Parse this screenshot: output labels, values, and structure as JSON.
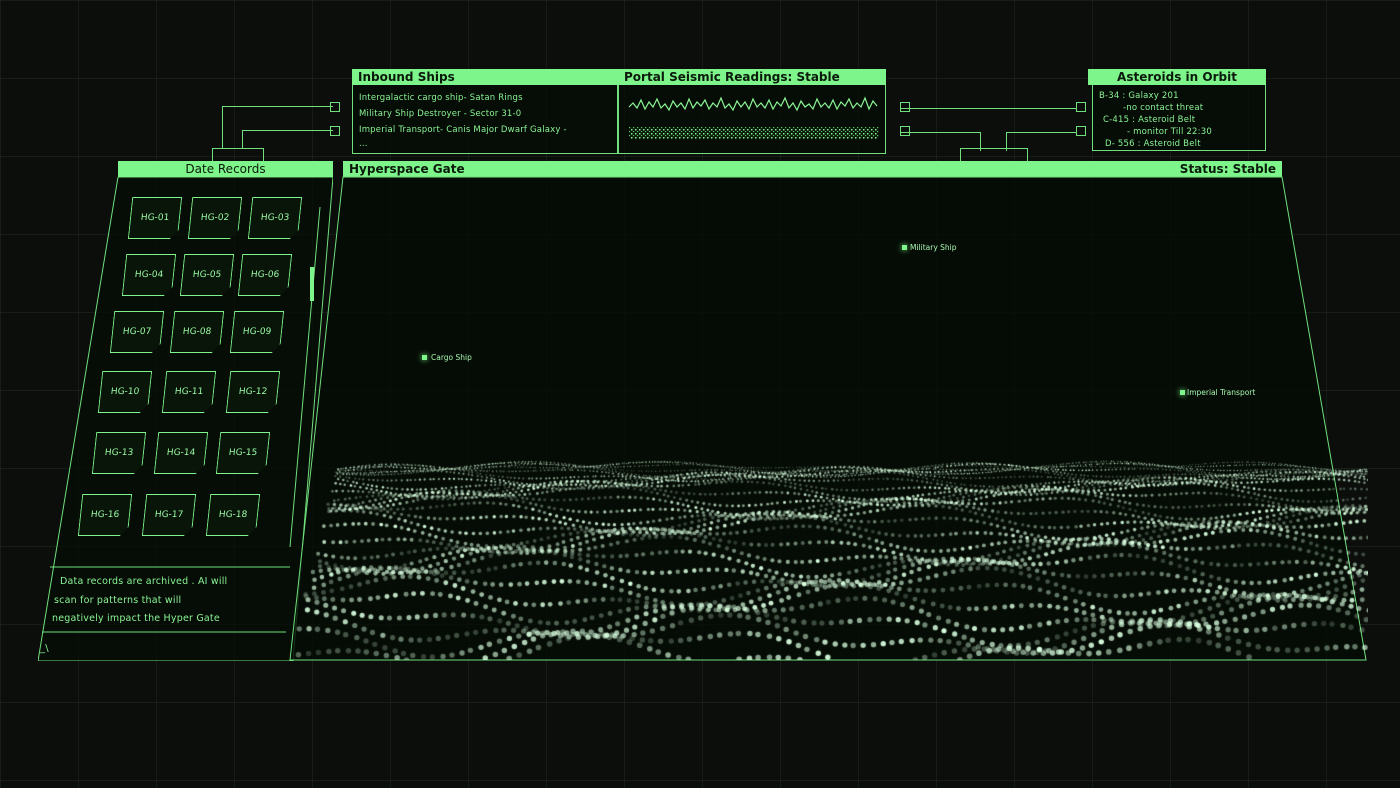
{
  "inbound_ships": {
    "title": "Inbound Ships",
    "items": [
      "Intergalactic cargo ship- Satan Rings",
      "Military Ship Destroyer - Sector 31-0",
      "Imperial Transport- Canis Major Dwarf Galaxy -",
      "..."
    ]
  },
  "seismic": {
    "title": "Portal Seismic Readings: Stable"
  },
  "asteroids": {
    "title": "Asteroids in Orbit",
    "lines": [
      "B-34 : Galaxy 201",
      "-no contact threat",
      "C-415 : Asteroid Belt",
      "- monitor Till 22:30",
      "D- 556 : Asteroid Belt"
    ]
  },
  "date_records": {
    "title": "Date Records",
    "tiles": [
      "HG-01",
      "HG-02",
      "HG-03",
      "HG-04",
      "HG-05",
      "HG-06",
      "HG-07",
      "HG-08",
      "HG-09",
      "HG-10",
      "HG-11",
      "HG-12",
      "HG-13",
      "HG-14",
      "HG-15",
      "HG-16",
      "HG-17",
      "HG-18"
    ],
    "note": [
      "Data records are archived . AI will",
      "scan for patterns that will",
      "negatively impact the Hyper Gate"
    ],
    "prompt": "_\\"
  },
  "hyperspace": {
    "title": "Hyperspace Gate",
    "status": "Status: Stable",
    "markers": [
      "Military Ship",
      "Cargo Ship",
      "Imperial Transport"
    ]
  },
  "colors": {
    "accent": "#7ef58a",
    "background": "#0b0e0b",
    "particle": "#d9ffe0"
  }
}
